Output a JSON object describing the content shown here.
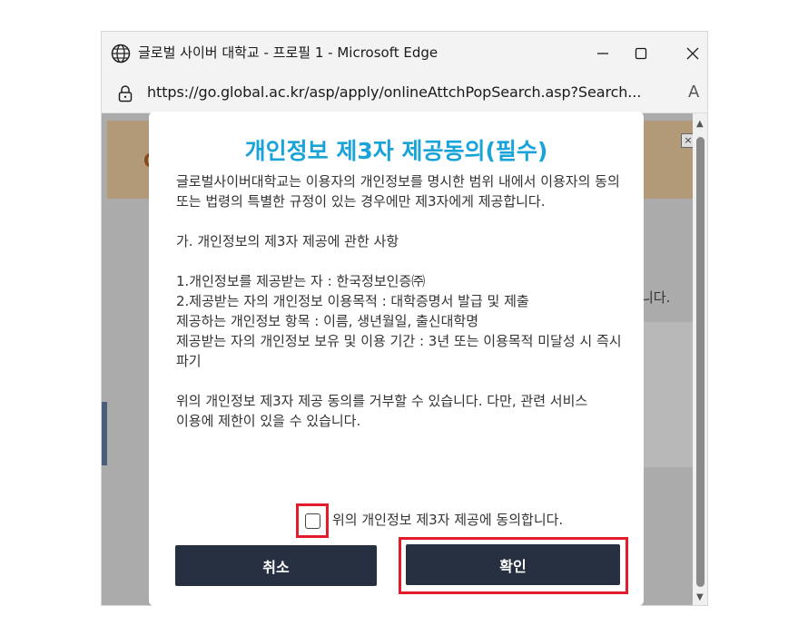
{
  "window": {
    "title": "글로벌 사이버 대학교 - 프로필 1 - Microsoft Edge",
    "url": "https://go.global.ac.kr/asp/apply/onlineAttchPopSearch.asp?Search...",
    "read_aloud": "A"
  },
  "background": {
    "banner_glyph": "O",
    "close_glyph": "×",
    "partial_text": "니다."
  },
  "modal": {
    "title": "개인정보 제3자 제공동의(필수)",
    "intro": "글로벌사이버대학교는 이용자의 개인정보를 명시한 범위 내에서 이용자의 동의 또는 법령의 특별한 규정이 있는 경우에만 제3자에게 제공합니다.",
    "section_heading": "가. 개인정보의 제3자 제공에 관한 사항",
    "item1": "1.개인정보를 제공받는 자 : 한국정보인증㈜",
    "item2": "2.제공받는 자의 개인정보 이용목적 : 대학증명서 발급 및 제출",
    "item3": "제공하는 개인정보 항목 : 이름, 생년월일, 출신대학명",
    "item4": "제공받는 자의 개인정보 보유 및 이용 기간 : 3년 또는 이용목적 미달성 시 즉시 파기",
    "notice": "위의 개인정보 제3자 제공 동의를 거부할 수 있습니다. 다만, 관련 서비스 이용에 제한이 있을 수 있습니다.",
    "consent_label": "위의 개인정보 제3자 제공에 동의합니다.",
    "consent_checked": false,
    "cancel_label": "취소",
    "confirm_label": "확인"
  },
  "colors": {
    "title_accent": "#1aa3d9",
    "button_bg": "#263040",
    "highlight": "#e21c2a"
  },
  "icons": {
    "browser": "globe-icon",
    "security": "lock-icon",
    "minimize": "minimize-icon",
    "maximize": "maximize-icon",
    "close": "close-icon"
  }
}
